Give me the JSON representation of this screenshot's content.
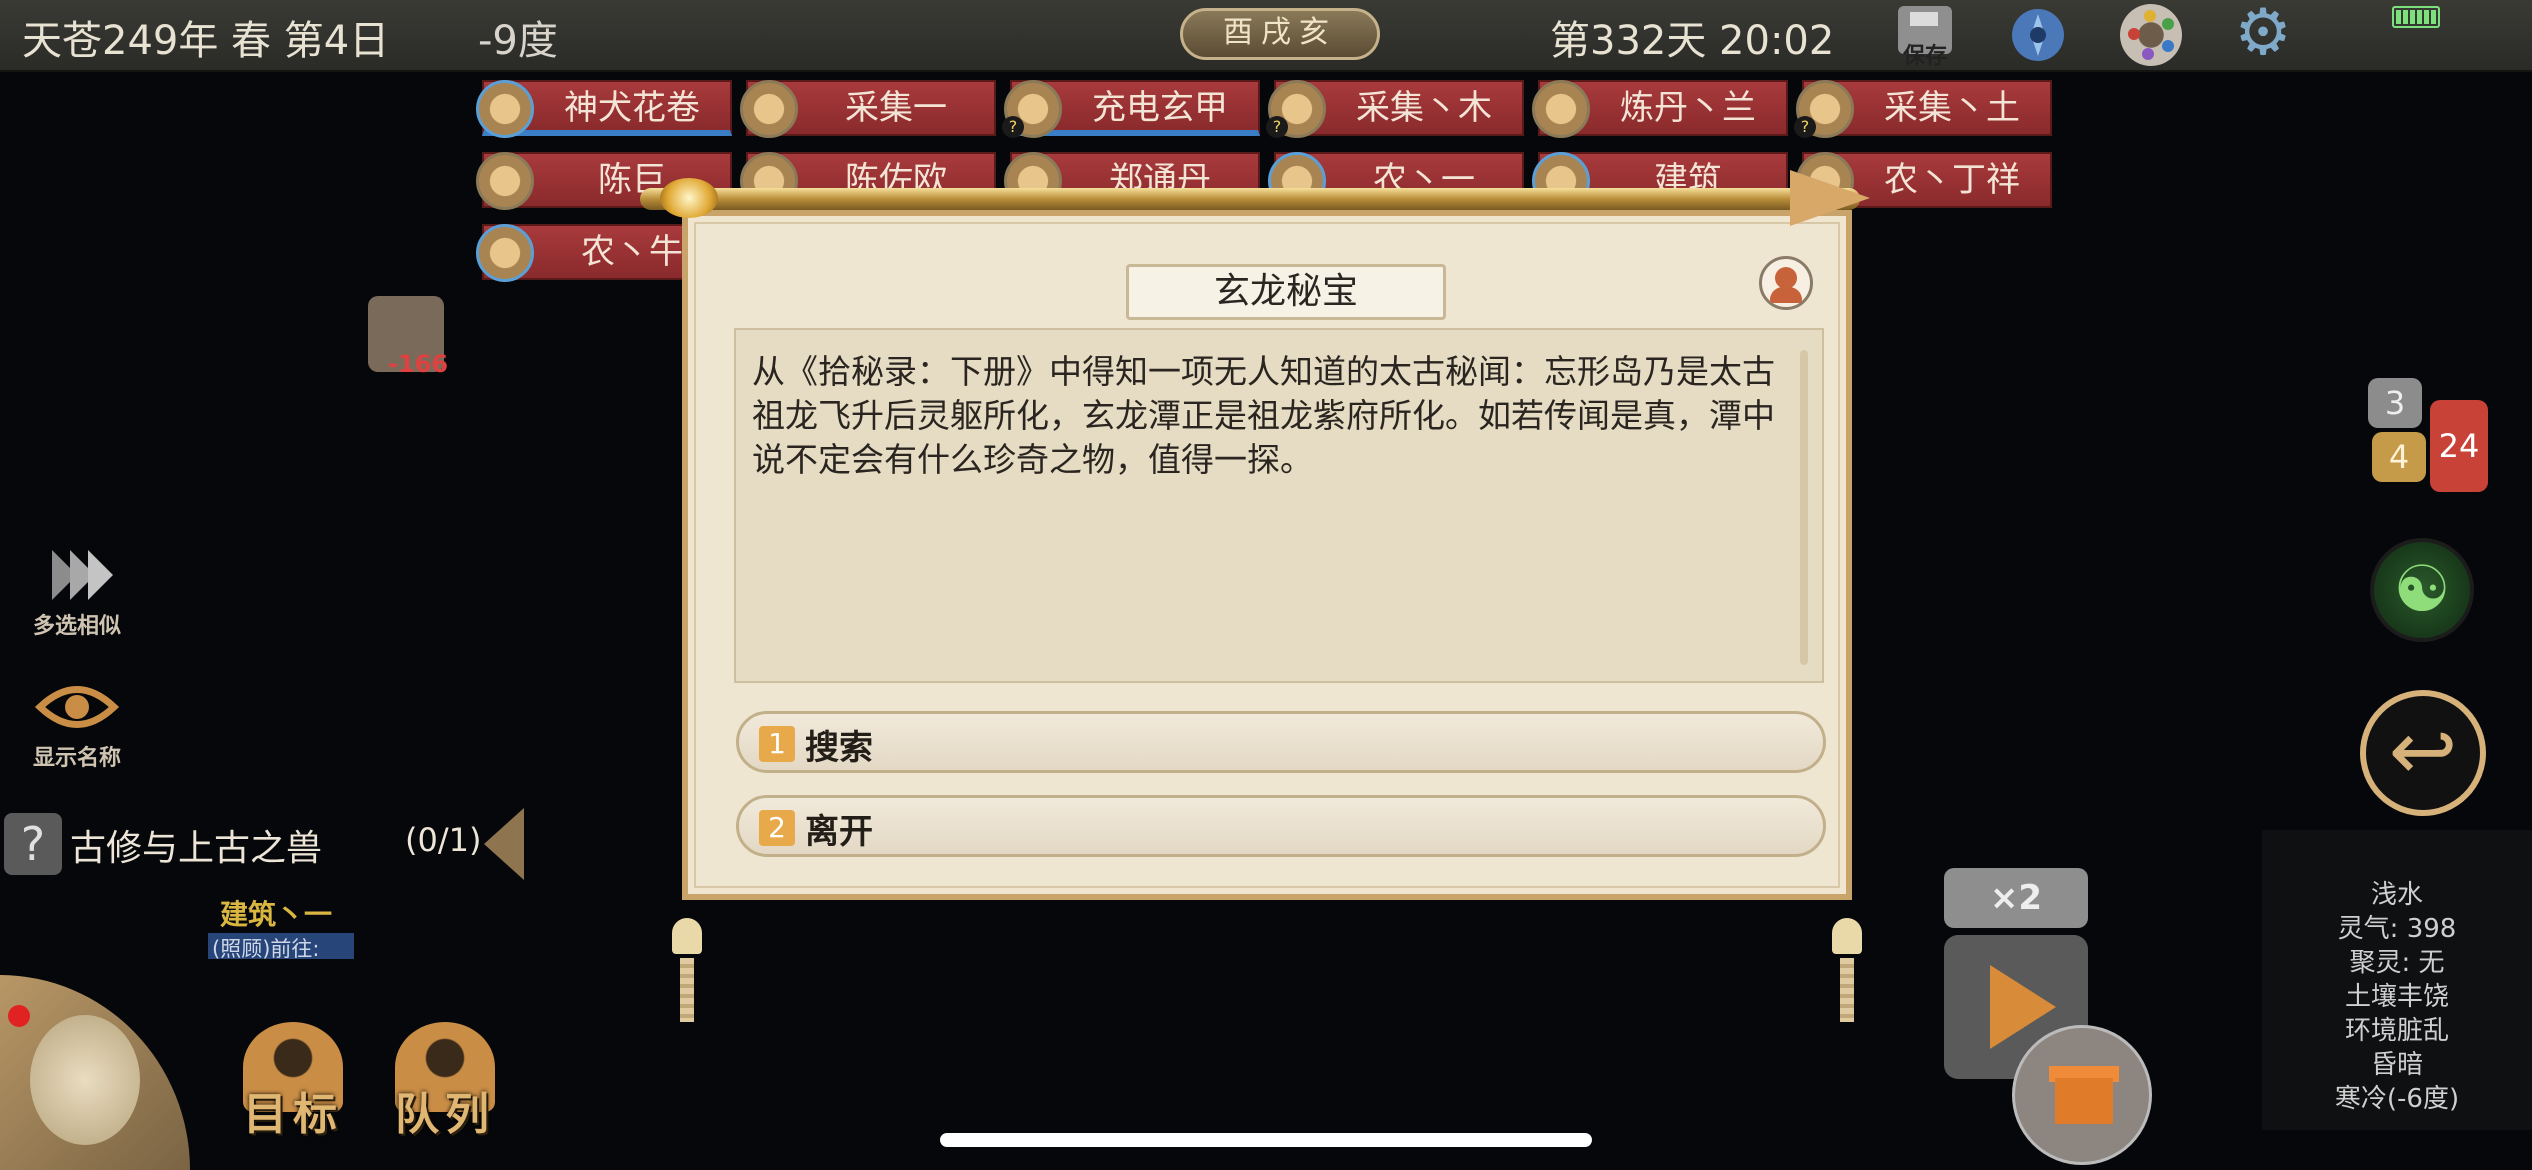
{
  "topbar": {
    "date": "天苍249年 春 第4日",
    "temperature": "-9度",
    "shichen": "酉戌亥",
    "day_time": "第332天 20:02",
    "save_label": "保存"
  },
  "tags_row1": [
    "神犬花卷",
    "采集一",
    "充电玄甲",
    "采集丶木",
    "炼丹丶兰",
    "采集丶土"
  ],
  "tags_row2": [
    "陈巨",
    "陈佐欧",
    "郑通丹",
    "农丶一",
    "建筑",
    "农丶丁祥"
  ],
  "tags_row3": [
    "农丶牛"
  ],
  "item": {
    "count": "-166"
  },
  "left_panel": {
    "multi_select": "多选相似",
    "show_names": "显示名称",
    "quest_title": "古修与上古之兽",
    "quest_progress": "(0/1)",
    "building_name": "建筑丶一",
    "building_sub": "(照顾)前往:"
  },
  "bottom_left": {
    "goal": "目标",
    "queue": "队列"
  },
  "right_panel": {
    "chat_gray": "3",
    "chat_gold": "4",
    "chat_red": "24",
    "speed": "×2",
    "env": [
      "浅水",
      "灵气: 398",
      "聚灵: 无",
      "土壤丰饶",
      "环境脏乱",
      "昏暗",
      "寒冷(-6度)"
    ]
  },
  "dialog": {
    "title": "玄龙秘宝",
    "text": "从《拾秘录：下册》中得知一项无人知道的太古秘闻：忘形岛乃是太古祖龙飞升后灵躯所化，玄龙潭正是祖龙紫府所化。如若传闻是真，潭中说不定会有什么珍奇之物，值得一探。",
    "options": [
      {
        "num": "1",
        "label": "搜索"
      },
      {
        "num": "2",
        "label": "离开"
      }
    ]
  },
  "colors": {
    "tag_red": "#a83a3c",
    "accent_gold": "#c9a46a",
    "option_num": "#e8a94a"
  }
}
